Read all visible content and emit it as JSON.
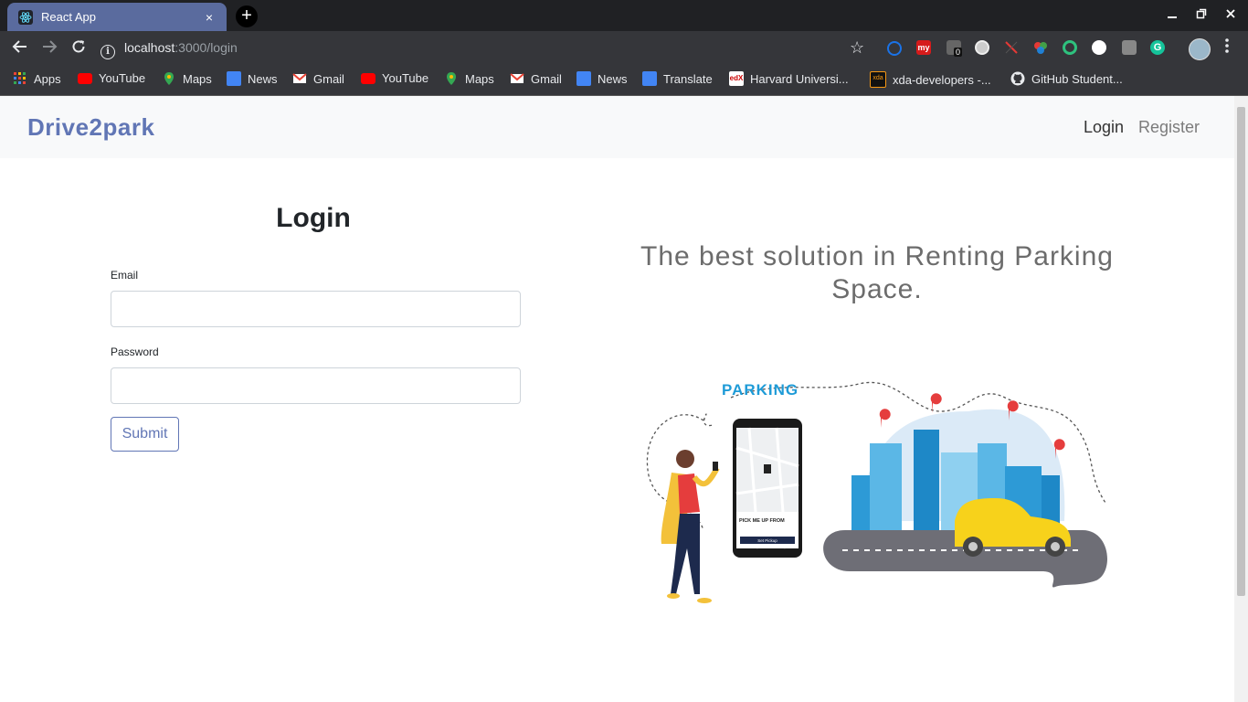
{
  "browser": {
    "tab_title": "React App",
    "tab_close": "×",
    "new_tab": "+",
    "url_host": "localhost",
    "url_path": ":3000/login",
    "ext_badge": "0",
    "bookmarks": [
      {
        "label": "Apps",
        "icon": "apps-grid-icon",
        "color": "#ea4335"
      },
      {
        "label": "YouTube",
        "icon": "youtube-icon",
        "color": "#ff0000"
      },
      {
        "label": "Maps",
        "icon": "maps-icon",
        "color": "#34a853"
      },
      {
        "label": "News",
        "icon": "news-icon",
        "color": "#4285f4"
      },
      {
        "label": "Gmail",
        "icon": "gmail-icon",
        "color": "#ea4335"
      },
      {
        "label": "YouTube",
        "icon": "youtube-icon",
        "color": "#ff0000"
      },
      {
        "label": "Maps",
        "icon": "maps-icon",
        "color": "#34a853"
      },
      {
        "label": "Gmail",
        "icon": "gmail-icon",
        "color": "#ea4335"
      },
      {
        "label": "News",
        "icon": "news-icon",
        "color": "#4285f4"
      },
      {
        "label": "Translate",
        "icon": "translate-icon",
        "color": "#4285f4"
      },
      {
        "label": "Harvard Universi...",
        "icon": "edx-icon",
        "color": "#ffffff"
      },
      {
        "label": "xda-developers -...",
        "icon": "xda-icon",
        "color": "#f59714"
      },
      {
        "label": "GitHub Student...",
        "icon": "github-icon",
        "color": "#e8eaed"
      }
    ]
  },
  "navbar": {
    "brand": "Drive2park",
    "login": "Login",
    "register": "Register"
  },
  "form": {
    "title": "Login",
    "email_label": "Email",
    "email_value": "",
    "password_label": "Password",
    "password_value": "",
    "submit": "Submit"
  },
  "hero": {
    "tagline": "The best solution in Renting Parking Space.",
    "parking_sign": "PARKING",
    "phone_pickup": "PICK ME UP FROM",
    "phone_button": "Set Pickup"
  },
  "colors": {
    "brand": "#6176b5",
    "tab": "#5a6b9e",
    "accent_parking": "#1e9bd7",
    "taxi": "#f7d21b"
  }
}
